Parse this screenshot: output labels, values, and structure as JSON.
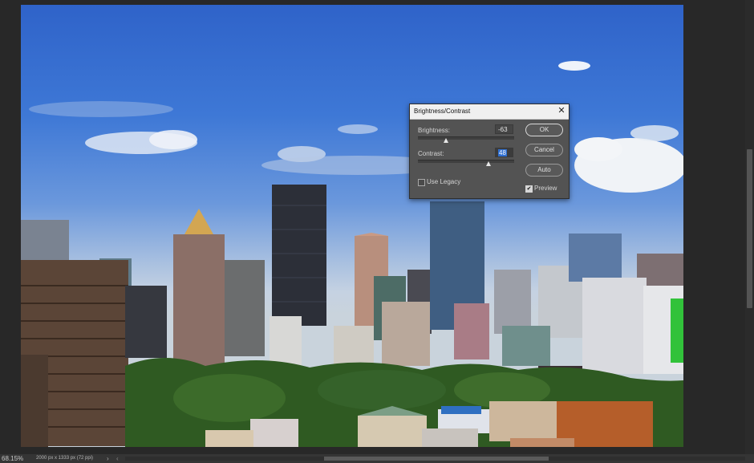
{
  "status_bar": {
    "zoom": "68.15%",
    "doc_info": "2000 px x 1333 px (72 ppi)",
    "arrow": "›",
    "scroll_left": "‹"
  },
  "dialog": {
    "title": "Brightness/Contrast",
    "close_glyph": "✕",
    "brightness_label": "Brightness:",
    "brightness_value": "-63",
    "contrast_label": "Contrast:",
    "contrast_value": "48",
    "use_legacy_label": "Use Legacy",
    "use_legacy_checked": false,
    "preview_label": "Preview",
    "preview_checked": true,
    "preview_check_glyph": "✔",
    "ok_label": "OK",
    "cancel_label": "Cancel",
    "auto_label": "Auto"
  },
  "icons": {
    "close": "close-icon",
    "checkbox": "checkbox-icon",
    "slider_thumb": "triangle-thumb-icon"
  }
}
